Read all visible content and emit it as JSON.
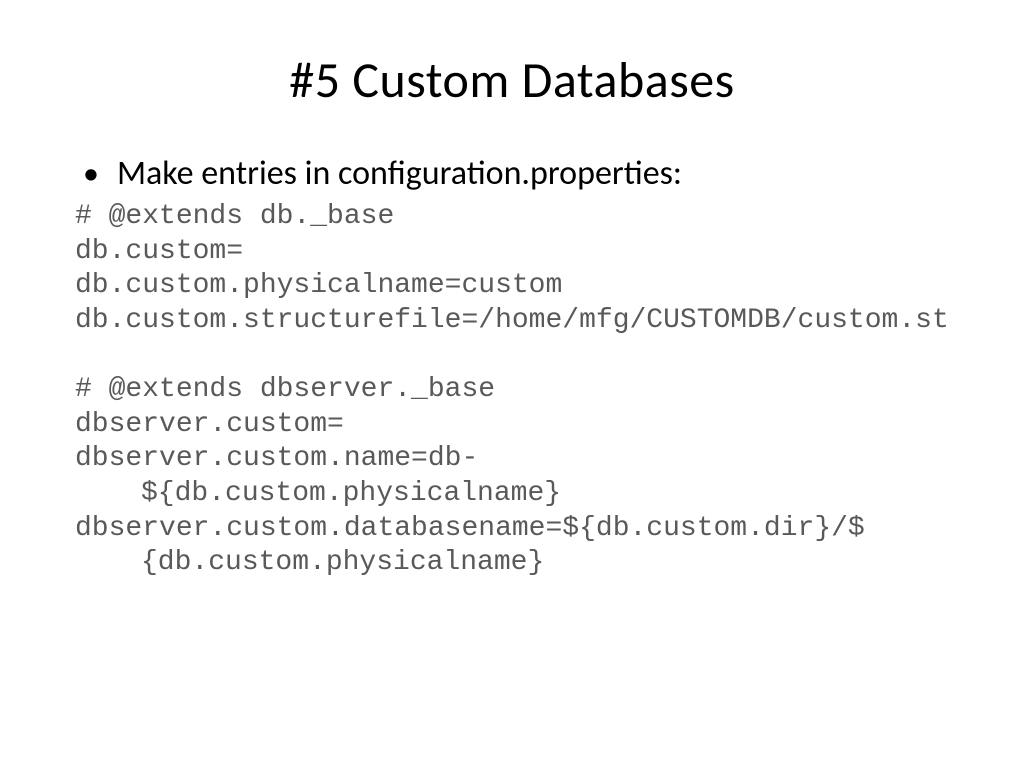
{
  "slide": {
    "title": "#5 Custom Databases",
    "bullet": "Make entries in configuration.properties:",
    "code": {
      "line1": "# @extends db._base",
      "line2": "db.custom=",
      "line3": "db.custom.physicalname=custom",
      "line4": "db.custom.structurefile=/home/mfg/CUSTOMDB/custom.st",
      "line5": "# @extends dbserver._base",
      "line6": "dbserver.custom=",
      "line7a": "dbserver.custom.name=db-",
      "line7b": "${db.custom.physicalname}",
      "line8a": "dbserver.custom.databasename=${db.custom.dir}/$",
      "line8b": "{db.custom.physicalname}"
    }
  }
}
